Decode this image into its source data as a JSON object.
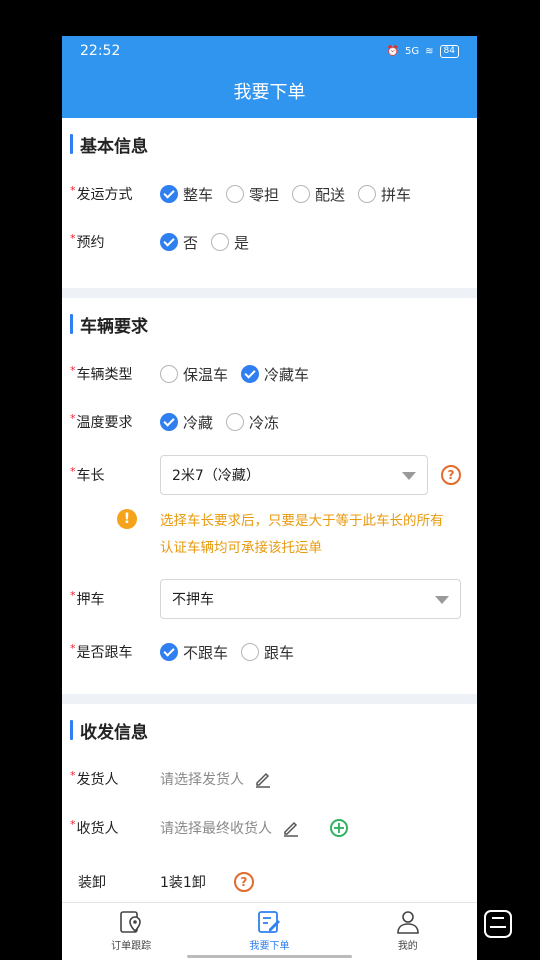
{
  "status_bar": {
    "time": "22:52",
    "network": "5G",
    "battery": "84"
  },
  "app_bar": {
    "title": "我要下单"
  },
  "basic_info": {
    "title": "基本信息",
    "ship_method": {
      "label": "发运方式",
      "options": [
        "整车",
        "零担",
        "配送",
        "拼车"
      ],
      "selected": "整车"
    },
    "reservation": {
      "label": "预约",
      "options": [
        "否",
        "是"
      ],
      "selected": "否"
    }
  },
  "vehicle_req": {
    "title": "车辆要求",
    "vehicle_type": {
      "label": "车辆类型",
      "options": [
        "保温车",
        "冷藏车"
      ],
      "selected": "冷藏车"
    },
    "temperature": {
      "label": "温度要求",
      "options": [
        "冷藏",
        "冷冻"
      ],
      "selected": "冷藏"
    },
    "vehicle_length": {
      "label": "车长",
      "value": "2米7（冷藏）"
    },
    "notice": "选择车长要求后，只要是大于等于此车长的所有认证车辆均可承接该托运单",
    "escort": {
      "label": "押车",
      "value": "不押车"
    },
    "follow": {
      "label": "是否跟车",
      "options": [
        "不跟车",
        "跟车"
      ],
      "selected": "不跟车"
    }
  },
  "shipping_info": {
    "title": "收发信息",
    "shipper": {
      "label": "发货人",
      "placeholder": "请选择发货人"
    },
    "receiver": {
      "label": "收货人",
      "placeholder": "请选择最终收货人"
    },
    "loading": {
      "label": "装卸",
      "value": "1装1卸"
    }
  },
  "bottom_nav": {
    "items": [
      {
        "label": "订单跟踪",
        "icon": "location-doc-icon"
      },
      {
        "label": "我要下单",
        "icon": "edit-doc-icon",
        "active": true
      },
      {
        "label": "我的",
        "icon": "user-icon"
      }
    ]
  },
  "colors": {
    "primary": "#2f95ee",
    "accent": "#2f7ff0",
    "warning": "#e89a0e",
    "required": "#e23"
  }
}
